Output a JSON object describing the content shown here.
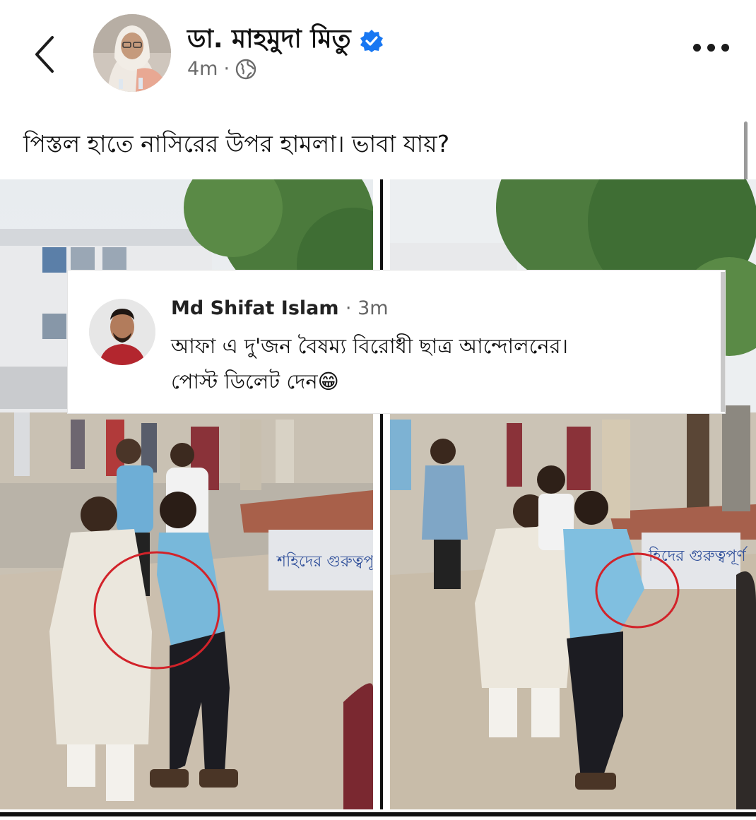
{
  "post": {
    "author_name": "ডা. মাহমুদা মিতু",
    "verified_icon": "verified-badge-icon",
    "time": "4m",
    "separator": "·",
    "privacy_icon": "globe-icon",
    "text": "পিস্তল হাতে নাসিরের উপর হামলা। ভাবা যায়?"
  },
  "comment": {
    "author_name": "Md Shifat Islam",
    "time": "· 3m",
    "line1": "আফা এ দু'জন বৈষম্য বিরোধী ছাত্র আন্দোলনের।",
    "line2": "পোস্ট ডিলেট দেন",
    "emoji": "😁"
  },
  "photos": {
    "left_banner_text": "শহিদের গুরুত্বপূর্ণ",
    "right_banner_text": "হিদের গুরুত্বপূর্ণ"
  },
  "colors": {
    "verified": "#1877f2",
    "annotation_circle": "#d2232a"
  }
}
